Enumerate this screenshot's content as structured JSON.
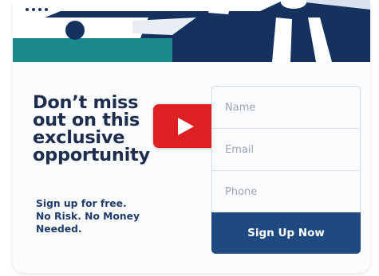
{
  "headline": {
    "lines": [
      "Don’t miss",
      "out on this",
      "exclusive",
      "opportunity"
    ]
  },
  "subtext": {
    "lines": [
      "Sign up for free.",
      "No Risk. No Money",
      "Needed."
    ]
  },
  "video": {
    "icon": "play-icon"
  },
  "form": {
    "name_placeholder": "Name",
    "email_placeholder": "Email",
    "phone_placeholder": "Phone",
    "submit_label": "Sign Up Now"
  },
  "colors": {
    "banner_navy": "#15325f",
    "banner_teal": "#1b8a8f",
    "play_red": "#dd2122",
    "button_blue": "#1f4a80",
    "headline_text": "#1c2d4e"
  }
}
